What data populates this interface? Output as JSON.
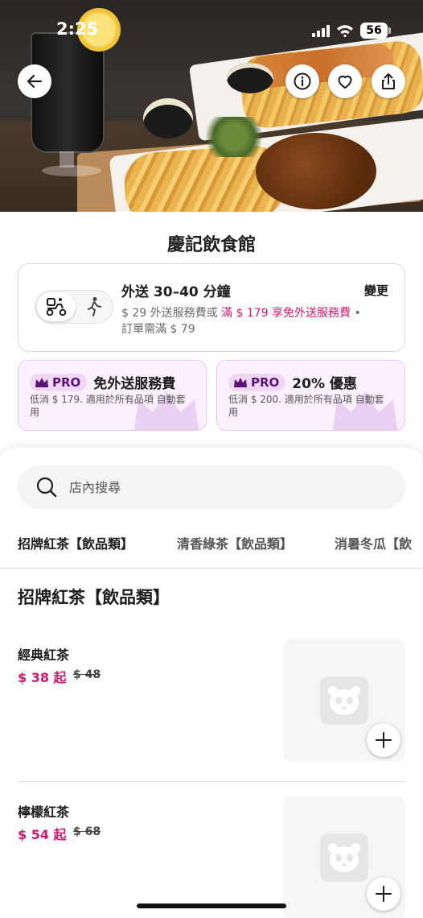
{
  "status_bar": {
    "time": "2:25",
    "battery": "56"
  },
  "hero": {
    "icons": [
      "back-arrow-icon",
      "info-icon",
      "heart-icon",
      "share-icon"
    ]
  },
  "restaurant": {
    "name": "慶記飲食館"
  },
  "delivery": {
    "title": "外送 30–40 分鐘",
    "change_label": "變更",
    "fee_prefix": "$ 29 外送服務費或",
    "fee_highlight": "滿 $ 179 享免外送服務費",
    "fee_suffix": "•",
    "min_order": "訂單需滿 $ 79",
    "modes": [
      "delivery-scooter-icon",
      "pickup-walk-icon"
    ]
  },
  "pro_cards": [
    {
      "badge": "PRO",
      "title": "免外送服務費",
      "desc": "低消 $ 179. 適用於所有品項 自動套用"
    },
    {
      "badge": "PRO",
      "title": "20% 優惠",
      "desc": "低消 $ 200. 適用於所有品項 自動套用"
    }
  ],
  "search": {
    "placeholder": "店內搜尋"
  },
  "tabs": [
    {
      "label": "招牌紅茶【飲品類】"
    },
    {
      "label": "清香綠茶【飲品類】"
    },
    {
      "label": "消暑冬瓜【飲"
    }
  ],
  "section": {
    "title": "招牌紅茶【飲品類】"
  },
  "items": [
    {
      "name": "經典紅茶",
      "price": "$ 38 起",
      "original_price": "$ 48"
    },
    {
      "name": "檸檬紅茶",
      "price": "$ 54 起",
      "original_price": "$ 68"
    }
  ],
  "colors": {
    "brand_pink": "#d0196f",
    "pro_purple": "#5b1377",
    "pro_bg": "#fbf0fd"
  }
}
